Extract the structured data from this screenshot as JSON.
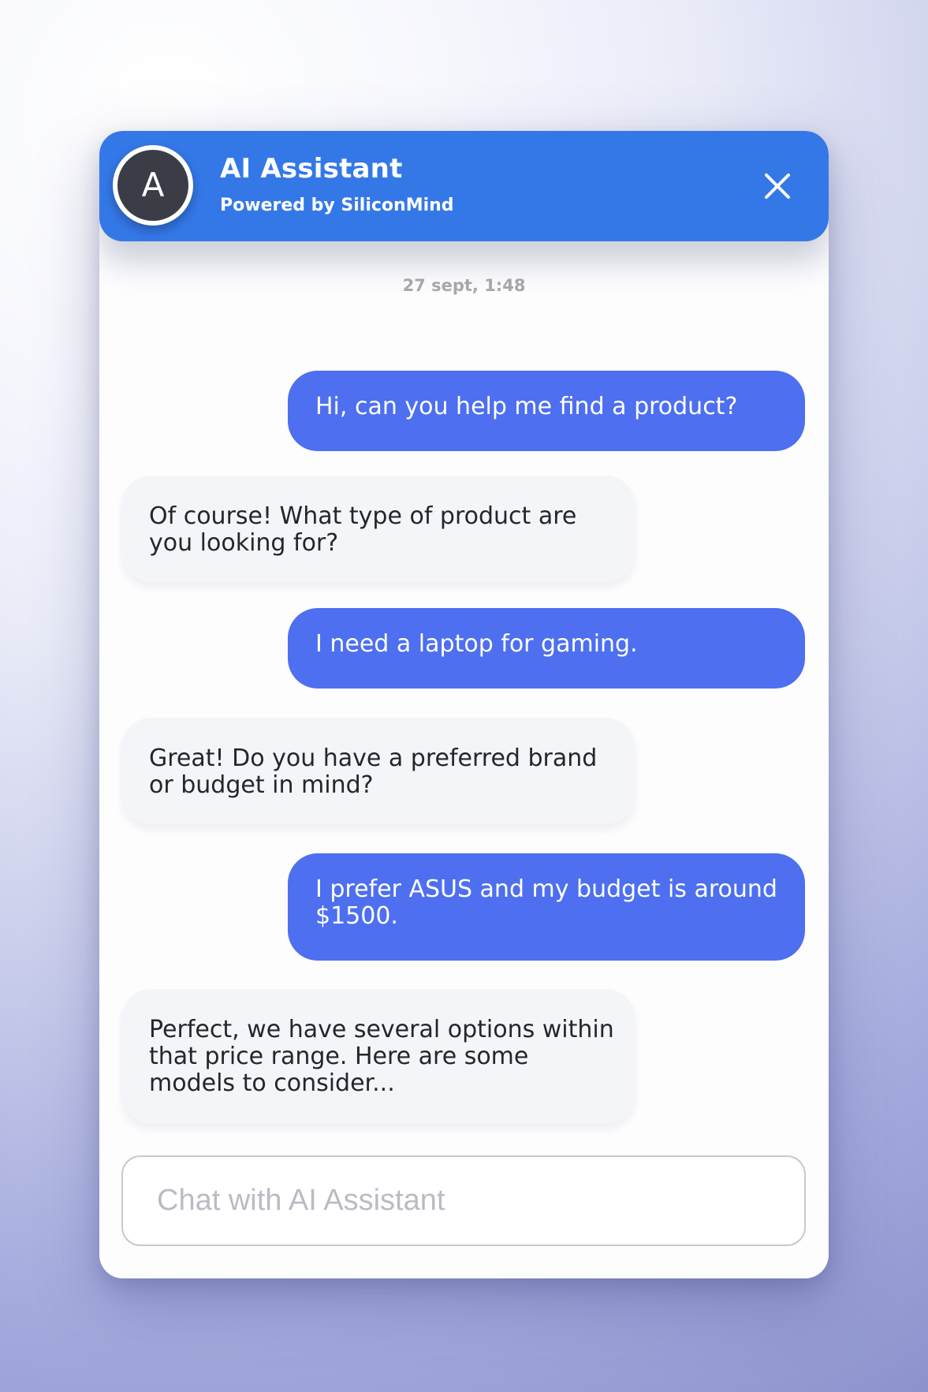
{
  "header": {
    "avatar_initial": "A",
    "title": "AI Assistant",
    "subtitle": "Powered by SiliconMind",
    "close_icon": "close-icon"
  },
  "conversation": {
    "timestamp": "27 sept, 1:48",
    "messages": [
      {
        "sender": "user",
        "text": "Hi, can you help me find a product?"
      },
      {
        "sender": "assistant",
        "text": "Of course! What type of product are you looking for?"
      },
      {
        "sender": "user",
        "text": "I need a laptop for gaming."
      },
      {
        "sender": "assistant",
        "text": "Great! Do you have a preferred brand or budget in mind?"
      },
      {
        "sender": "user",
        "text": "I prefer ASUS and my budget is around $1500."
      },
      {
        "sender": "assistant",
        "text": "Perfect, we have several options within that price range. Here are some models to consider..."
      }
    ]
  },
  "composer": {
    "placeholder": "Chat with AI Assistant",
    "value": ""
  },
  "colors": {
    "header": "#3478e8",
    "user_bubble": "#4d6ff0",
    "assistant_bubble": "#f4f5f8",
    "avatar": "#3a3d45",
    "timestamp": "#a8a9ac",
    "input_border": "#c5c8cf"
  }
}
